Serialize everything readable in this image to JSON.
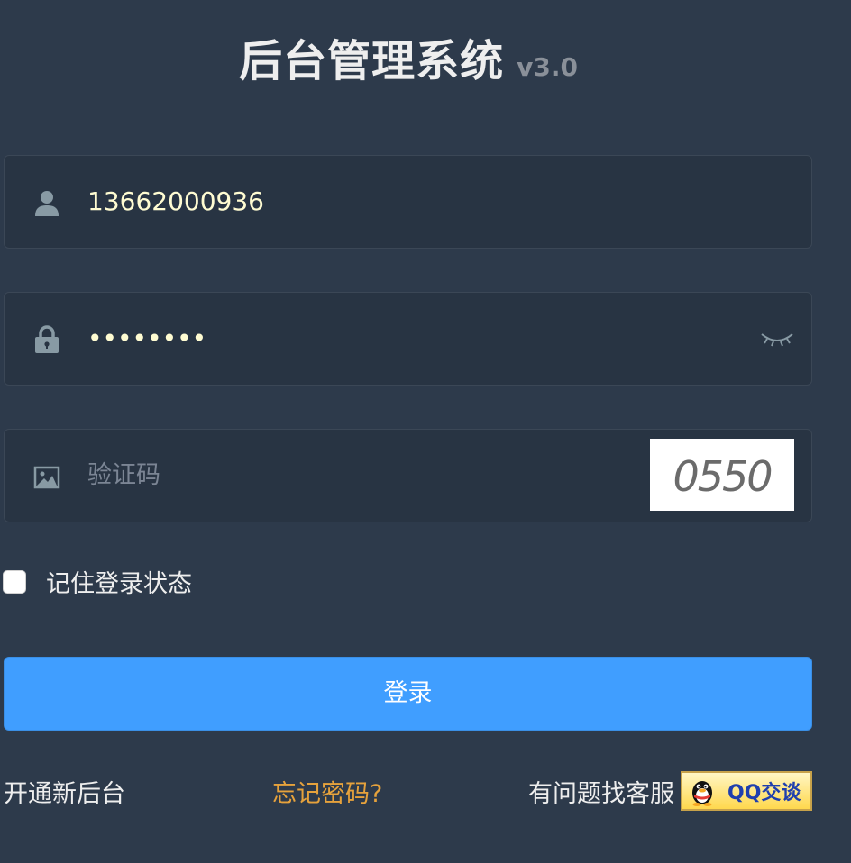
{
  "header": {
    "title": "后台管理系统",
    "version": "v3.0"
  },
  "form": {
    "username": {
      "icon": "user-icon",
      "value": "13662000936"
    },
    "password": {
      "icon": "lock-icon",
      "value": "••••••••",
      "toggle_icon": "eye-closed-icon"
    },
    "captcha": {
      "icon": "image-icon",
      "placeholder": "验证码",
      "image_text": "0550"
    },
    "remember": {
      "label": "记住登录状态",
      "checked": false
    },
    "login_button": "登录"
  },
  "footer": {
    "open_link": "开通新后台",
    "forgot_link": "忘记密码?",
    "help_text": "有问题找客服",
    "qq_button": "QQ交谈"
  },
  "colors": {
    "background": "#2d3a4b",
    "input_bg": "#283443",
    "primary": "#409eff",
    "warning": "#e6a23c",
    "input_text": "#fffcd2"
  }
}
